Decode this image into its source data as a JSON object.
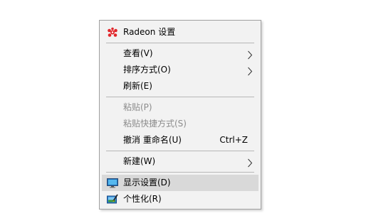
{
  "context_menu": {
    "items": [
      {
        "label": "Radeon 设置",
        "icon": "radeon-icon"
      },
      {
        "label": "查看(V)",
        "submenu": true
      },
      {
        "label": "排序方式(O)",
        "submenu": true
      },
      {
        "label": "刷新(E)"
      },
      {
        "label": "粘贴(P)",
        "disabled": true
      },
      {
        "label": "粘贴快捷方式(S)",
        "disabled": true
      },
      {
        "label": "撤消 重命名(U)",
        "shortcut": "Ctrl+Z"
      },
      {
        "label": "新建(W)",
        "submenu": true
      },
      {
        "label": "显示设置(D)",
        "icon": "display-icon",
        "highlighted": true
      },
      {
        "label": "个性化(R)",
        "icon": "personalize-icon"
      }
    ]
  },
  "colors": {
    "menu_background": "#f2f2f2",
    "highlight": "#d9d9d9",
    "disabled_text": "#8c8c8c",
    "radeon_red": "#e1262b"
  }
}
